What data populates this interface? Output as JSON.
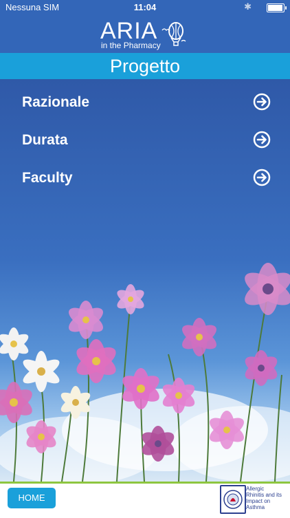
{
  "status_bar": {
    "carrier": "Nessuna SIM",
    "time": "11:04",
    "battery_level": 0.95
  },
  "header": {
    "logo_title": "ARIA",
    "logo_subtitle": "in the Pharmacy"
  },
  "page_title": "Progetto",
  "menu": {
    "items": [
      {
        "label": "Razionale",
        "icon": "arrow-right-circle-icon"
      },
      {
        "label": "Durata",
        "icon": "arrow-right-circle-icon"
      },
      {
        "label": "Faculty",
        "icon": "arrow-right-circle-icon"
      }
    ]
  },
  "footer": {
    "home_label": "HOME",
    "aria_logo_text": [
      "Allergic",
      "Rhinitis and its",
      "Impact on",
      "Asthma"
    ]
  },
  "colors": {
    "header_bg": "#3366b8",
    "title_bar_bg": "#1aa0da",
    "footer_accent": "#8dc63f"
  }
}
